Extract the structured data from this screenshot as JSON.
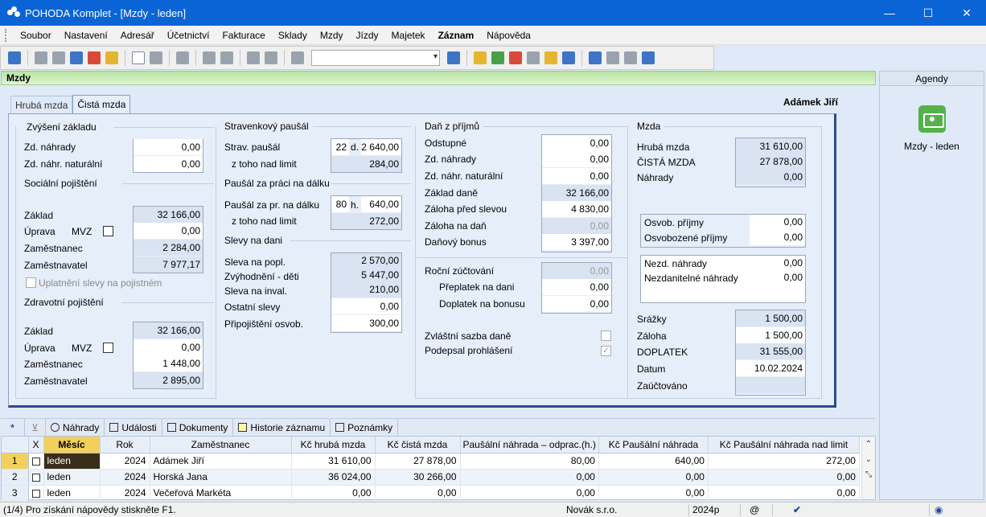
{
  "window": {
    "title": "POHODA Komplet - [Mzdy - leden]",
    "minimize": "—",
    "maximize": "☐",
    "close": "✕"
  },
  "menu": [
    "Soubor",
    "Nastavení",
    "Adresář",
    "Účetnictví",
    "Fakturace",
    "Sklady",
    "Mzdy",
    "Jízdy",
    "Majetek",
    "Záznam",
    "Nápověda"
  ],
  "agenda_header": "Mzdy",
  "right_panel": {
    "header": "Agendy",
    "item_label": "Mzdy - leden"
  },
  "tabs": [
    "Hrubá mzda",
    "Čistá mzda"
  ],
  "employee_name": "Adámek Jiří",
  "zvyseni": {
    "title": "Zvýšení základu",
    "zd_nahrady_label": "Zd. náhrady",
    "zd_nahrady": "0,00",
    "zd_nahr_nat_label": "Zd. náhr. naturální",
    "zd_nahr_nat": "0,00"
  },
  "socialni": {
    "title": "Sociální pojištění",
    "zaklad_label": "Základ",
    "zaklad": "32 166,00",
    "uprava_label": "Úprava",
    "mvz_label": "MVZ",
    "uprava": "0,00",
    "zamestnanec_label": "Zaměstnanec",
    "zamestnanec": "2 284,00",
    "zamestnavatel_label": "Zaměstnavatel",
    "zamestnavatel": "7 977,17",
    "sleva_label": "Uplatnění slevy na pojistném"
  },
  "zdravotni": {
    "title": "Zdravotní pojištění",
    "zaklad_label": "Základ",
    "zaklad": "32 166,00",
    "uprava_label": "Úprava",
    "mvz_label": "MVZ",
    "uprava": "0,00",
    "zamestnanec_label": "Zaměstnanec",
    "zamestnanec": "1 448,00",
    "zamestnavatel_label": "Zaměstnavatel",
    "zamestnavatel": "2 895,00"
  },
  "stravenky": {
    "title": "Stravenkový paušál",
    "strav_label": "Strav. paušál",
    "strav_days": "22",
    "strav_unit": "d.",
    "strav_value": "2 640,00",
    "nad_limit_label": "z toho nad limit",
    "nad_limit": "284,00"
  },
  "pausal": {
    "title": "Paušál za práci na dálku",
    "label": "Paušál za pr. na dálku",
    "hours": "80",
    "unit": "h.",
    "value": "640,00",
    "nad_limit_label": "z toho nad limit",
    "nad_limit": "272,00"
  },
  "slevy": {
    "title": "Slevy na dani",
    "popl_label": "Sleva na popl.",
    "popl": "2 570,00",
    "deti_label": "Zvýhodnění - děti",
    "deti": "5 447,00",
    "inval_label": "Sleva na inval.",
    "inval": "210,00",
    "ostatni_label": "Ostatní slevy",
    "ostatni": "0,00",
    "osvob_label": "Připojištění osvob.",
    "osvob": "300,00"
  },
  "dan": {
    "title": "Daň z příjmů",
    "odstupne_label": "Odstupné",
    "odstupne": "0,00",
    "zd_nahrady_label": "Zd. náhrady",
    "zd_nahrady": "0,00",
    "zd_nahr_nat_label": "Zd. náhr. naturální",
    "zd_nahr_nat": "0,00",
    "zaklad_label": "Základ daně",
    "zaklad": "32 166,00",
    "zaloha_pred_label": "Záloha před slevou",
    "zaloha_pred": "4 830,00",
    "zaloha_dan_label": "Záloha na daň",
    "zaloha_dan": "0,00",
    "bonus_label": "Daňový bonus",
    "bonus": "3 397,00",
    "rocni_label": "Roční zúčtování",
    "rocni": "0,00",
    "preplatek_label": "Přeplatek na dani",
    "preplatek": "0,00",
    "doplatek_label": "Doplatek na bonusu",
    "doplatek": "0,00",
    "zvlastni_label": "Zvláštní sazba daně",
    "podepsal_label": "Podepsal prohlášení"
  },
  "mzda": {
    "title": "Mzda",
    "hruba_label": "Hrubá mzda",
    "hruba": "31 610,00",
    "cista_label": "ČISTÁ MZDA",
    "cista": "27 878,00",
    "nahrady_label": "Náhrady",
    "nahrady": "0,00",
    "osvob_prijmy_label": "Osvob. příjmy",
    "osvob_prijmy": "0,00",
    "osvobozene_label": "Osvobozené příjmy",
    "osvobozene": "0,00",
    "nezd_label": "Nezd. náhrady",
    "nezd": "0,00",
    "nezdanitelne_label": "Nezdanitelné náhrady",
    "nezdanitelne": "0,00",
    "srazky_label": "Srážky",
    "srazky": "1 500,00",
    "zaloha_label": "Záloha",
    "zaloha": "1 500,00",
    "doplatek_label": "DOPLATEK",
    "doplatek": "31 555,00",
    "datum_label": "Datum",
    "datum": "10.02.2024",
    "zauctovano_label": "Zaúčtováno"
  },
  "bottom_tabs": {
    "star": "*",
    "nahrady": "Náhrady",
    "udalosti": "Události",
    "dokumenty": "Dokumenty",
    "historie": "Historie záznamu",
    "poznamky": "Poznámky"
  },
  "table": {
    "columns": [
      "X",
      "Měsíc",
      "Rok",
      "Zaměstnanec",
      "Kč hrubá mzda",
      "Kč čistá mzda",
      "Paušální náhrada – odprac.(h.)",
      "Kč Paušální náhrada",
      "Kč Paušální náhrada nad limit"
    ],
    "rows": [
      {
        "n": "1",
        "mesic": "leden",
        "rok": "2024",
        "jmeno": "Adámek Jiří",
        "hruba": "31 610,00",
        "cista": "27 878,00",
        "odprac": "80,00",
        "pausal": "640,00",
        "nad_limit": "272,00"
      },
      {
        "n": "2",
        "mesic": "leden",
        "rok": "2024",
        "jmeno": "Horská Jana",
        "hruba": "36 024,00",
        "cista": "30 266,00",
        "odprac": "0,00",
        "pausal": "0,00",
        "nad_limit": "0,00"
      },
      {
        "n": "3",
        "mesic": "leden",
        "rok": "2024",
        "jmeno": "Večeřová Markéta",
        "hruba": "0,00",
        "cista": "0,00",
        "odprac": "0,00",
        "pausal": "0,00",
        "nad_limit": "0,00"
      }
    ]
  },
  "status": {
    "help": "(1/4) Pro získání nápovědy stiskněte F1.",
    "company": "Novák  s.r.o.",
    "year": "2024p",
    "at": "@"
  }
}
